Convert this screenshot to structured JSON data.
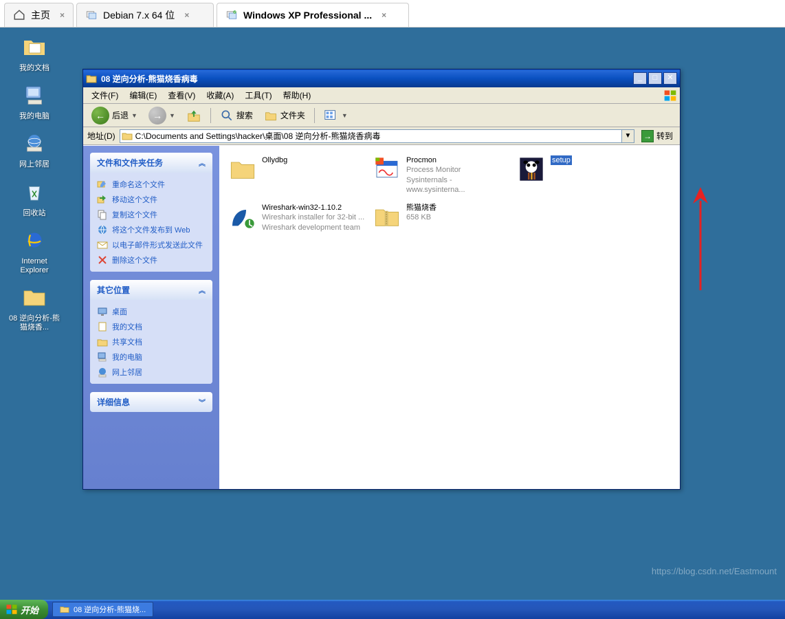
{
  "app_tabs": {
    "home": "主页",
    "debian": "Debian 7.x 64 位",
    "winxp": "Windows XP Professional ..."
  },
  "desktop_icons": {
    "docs": "我的文档",
    "computer": "我的电脑",
    "network": "网上邻居",
    "recycle": "回收站",
    "ie": "Internet Explorer",
    "folder_analysis": "08 逆向分析-熊猫烧香..."
  },
  "explorer": {
    "title": "08 逆向分析-熊猫烧香病毒",
    "menu": {
      "file": "文件(F)",
      "edit": "编辑(E)",
      "view": "查看(V)",
      "fav": "收藏(A)",
      "tools": "工具(T)",
      "help": "帮助(H)"
    },
    "toolbar": {
      "back": "后退",
      "search": "搜索",
      "folders": "文件夹"
    },
    "address_label": "地址(D)",
    "address_value": "C:\\Documents and Settings\\hacker\\桌面\\08 逆向分析-熊猫烧香病毒",
    "go": "转到",
    "side": {
      "tasks_title": "文件和文件夹任务",
      "tasks": {
        "rename": "重命名这个文件",
        "move": "移动这个文件",
        "copy": "复制这个文件",
        "publish": "将这个文件发布到 Web",
        "email": "以电子邮件形式发送此文件",
        "delete": "删除这个文件"
      },
      "places_title": "其它位置",
      "places": {
        "desktop": "桌面",
        "mydocs": "我的文档",
        "shared": "共享文档",
        "mycomp": "我的电脑",
        "netplaces": "网上邻居"
      },
      "details_title": "详细信息"
    },
    "files": {
      "ollydbg": {
        "name": "Ollydbg"
      },
      "procmon": {
        "name": "Procmon",
        "sub1": "Process Monitor",
        "sub2": "Sysinternals - www.sysinterna..."
      },
      "setup": {
        "name": "setup"
      },
      "wireshark": {
        "name": "Wireshark-win32-1.10.2",
        "sub1": "Wireshark installer for 32-bit ...",
        "sub2": "Wireshark development team"
      },
      "panda": {
        "name": "熊猫烧香",
        "sub1": "658 KB"
      }
    }
  },
  "taskbar": {
    "start": "开始",
    "task1": "08 逆向分析-熊猫烧..."
  },
  "watermark": "https://blog.csdn.net/Eastmount"
}
